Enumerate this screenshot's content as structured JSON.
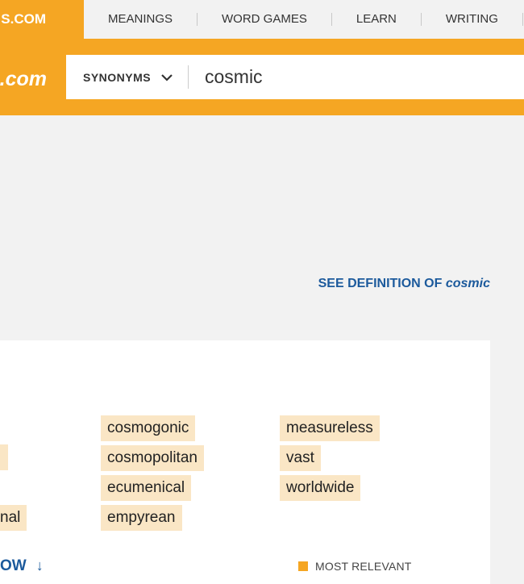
{
  "brand": {
    "top_text": "S.COM",
    "main_text": "s.com"
  },
  "nav": {
    "items": [
      "MEANINGS",
      "WORD GAMES",
      "LEARN",
      "WRITING"
    ]
  },
  "search": {
    "type_label": "SYNONYMS",
    "query": "cosmic"
  },
  "definition_link": {
    "prefix": "SEE DEFINITION OF",
    "word": "cosmic"
  },
  "synonyms": {
    "partial_left": [
      "",
      "nal"
    ],
    "col2": [
      "cosmogonic",
      "cosmopolitan",
      "ecumenical",
      "empyrean"
    ],
    "col3": [
      "measureless",
      "vast",
      "worldwide"
    ]
  },
  "more_link": {
    "label": "OW",
    "icon": "arrow-down-icon"
  },
  "legend": {
    "label": "MOST RELEVANT"
  },
  "colors": {
    "brand": "#f5a623",
    "highlight": "#fae6c5",
    "link": "#1c5a9c"
  }
}
